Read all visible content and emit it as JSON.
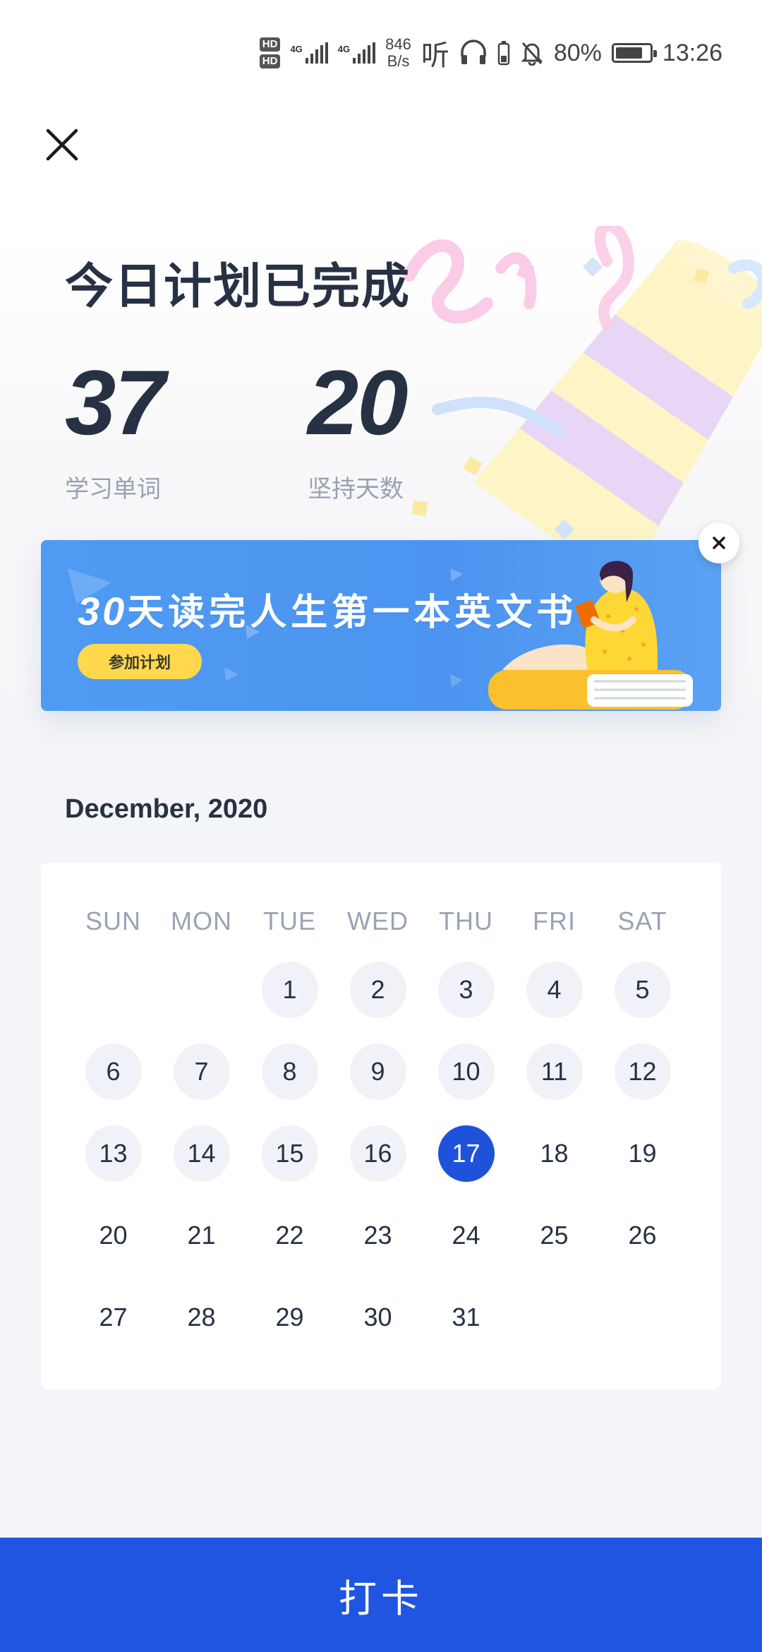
{
  "status_bar": {
    "hd1": "HD",
    "hd2": "HD",
    "net1": "4G",
    "net2": "4G",
    "speed_value": "846",
    "speed_unit": "B/s",
    "listen": "听",
    "battery_percent": "80%",
    "time": "13:26",
    "battery_level": 0.8
  },
  "header": {
    "title": "今日计划已完成"
  },
  "stats": [
    {
      "value": "37",
      "label": "学习单词"
    },
    {
      "value": "20",
      "label": "坚持天数"
    }
  ],
  "banner": {
    "number": "30",
    "text": "天读完人生第一本英文书",
    "button_label": "参加计划"
  },
  "calendar": {
    "month_label": "December, 2020",
    "weekdays": [
      "SUN",
      "MON",
      "TUE",
      "WED",
      "THU",
      "FRI",
      "SAT"
    ],
    "weeks": [
      [
        "",
        "",
        "1",
        "2",
        "3",
        "4",
        "5"
      ],
      [
        "6",
        "7",
        "8",
        "9",
        "10",
        "11",
        "12"
      ],
      [
        "13",
        "14",
        "15",
        "16",
        "17",
        "18",
        "19"
      ],
      [
        "20",
        "21",
        "22",
        "23",
        "24",
        "25",
        "26"
      ],
      [
        "27",
        "28",
        "29",
        "30",
        "31",
        "",
        ""
      ]
    ],
    "today": "17",
    "completed_through": 16
  },
  "footer": {
    "checkin_label": "打卡"
  },
  "colors": {
    "accent": "#1f55e0",
    "banner_bg": "#4f9bf3",
    "banner_button": "#ffd84d",
    "text_dark": "#263244",
    "text_muted": "#98a1b2"
  },
  "icons": {
    "close": "close-icon",
    "banner_close": "close-icon",
    "headphones": "headphones-icon",
    "bell_off": "bell-off-icon",
    "battery": "battery-icon"
  }
}
